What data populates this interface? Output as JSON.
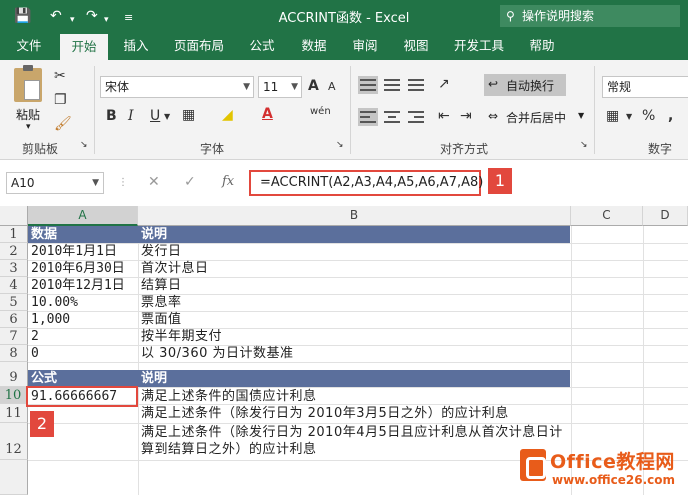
{
  "window": {
    "title": "ACCRINT函数  -  Excel",
    "tell_me": "操作说明搜索"
  },
  "ribbon": {
    "tabs": [
      "文件",
      "开始",
      "插入",
      "页面布局",
      "公式",
      "数据",
      "审阅",
      "视图",
      "开发工具",
      "帮助"
    ],
    "active_tab": "开始",
    "clipboard": {
      "paste_label": "粘贴",
      "group_label": "剪贴板"
    },
    "font": {
      "name": "宋体",
      "size": "11",
      "group_label": "字体",
      "bold": "B",
      "italic": "I",
      "underline": "U",
      "size_up": "A",
      "size_down": "A"
    },
    "alignment": {
      "wrap_text": "自动换行",
      "merge_center": "合并后居中",
      "group_label": "对齐方式"
    },
    "number": {
      "format": "常规",
      "group_label": "数字",
      "percent": "%"
    }
  },
  "formula_bar": {
    "name_box": "A10",
    "cancel": "✕",
    "enter": "✓",
    "fx": "fx",
    "formula": "=ACCRINT(A2,A3,A4,A5,A6,A7,A8)"
  },
  "callouts": {
    "one": "1",
    "two": "2"
  },
  "grid": {
    "columns": [
      "A",
      "B",
      "C",
      "D"
    ],
    "rows": [
      "1",
      "2",
      "3",
      "4",
      "5",
      "6",
      "7",
      "8",
      "9",
      "10",
      "11",
      "12"
    ],
    "header_row_1": {
      "a": "数据",
      "b": "说明"
    },
    "data_rows": [
      {
        "a": "2010年1月1日",
        "b": "发行日"
      },
      {
        "a": "2010年6月30日",
        "b": "首次计息日"
      },
      {
        "a": "2010年12月1日",
        "b": "结算日"
      },
      {
        "a": "10.00%",
        "b": "票息率"
      },
      {
        "a": "1,000",
        "b": "票面值"
      },
      {
        "a": "2",
        "b": "按半年期支付"
      },
      {
        "a": "0",
        "b": "以 30/360 为日计数基准"
      }
    ],
    "header_row_9": {
      "a": "公式",
      "b": "说明"
    },
    "row10": {
      "a": "91.66666667",
      "b": "满足上述条件的国债应计利息"
    },
    "row11": {
      "b": "满足上述条件（除发行日为 2010年3月5日之外）的应计利息"
    },
    "row12": {
      "b": "满足上述条件（除发行日为 2010年4月5日且应计利息从首次计息日计算到结算日之外）的应计利息"
    }
  },
  "watermark": {
    "name": "Office教程网",
    "url": "www.office26.com"
  },
  "colors": {
    "excel_green": "#217346",
    "header_band": "#5b6f9c",
    "callout_red": "#e2483d",
    "watermark_orange": "#e85c1a"
  }
}
